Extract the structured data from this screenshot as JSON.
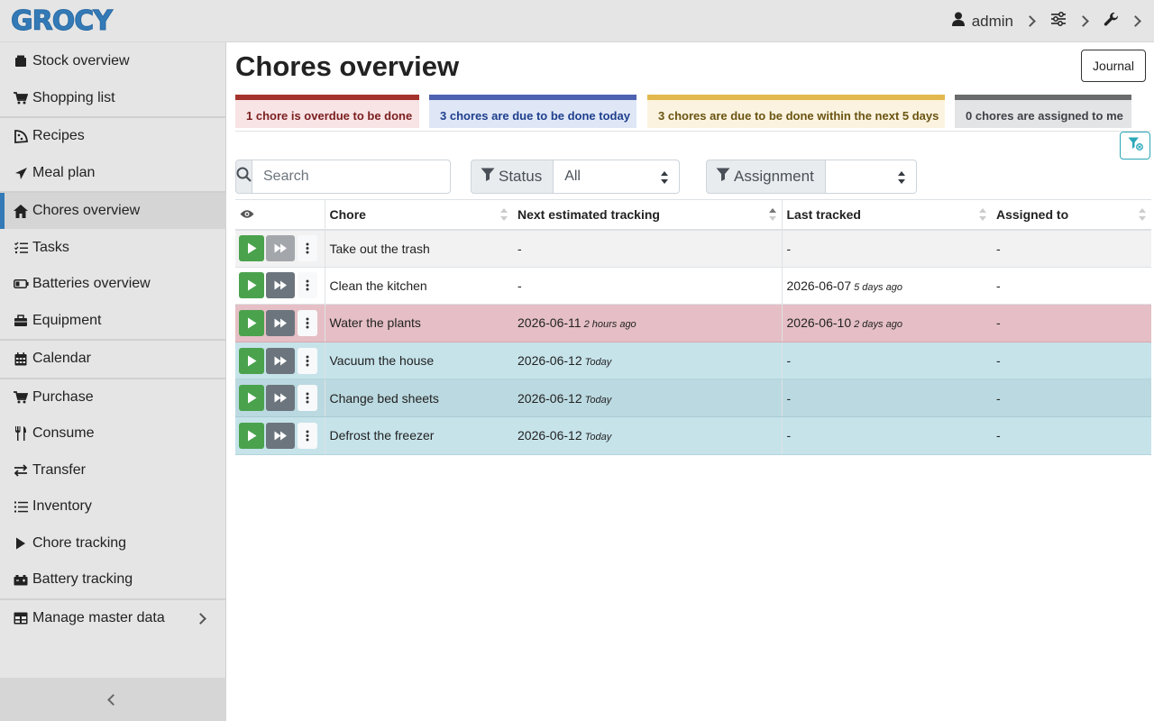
{
  "app": {
    "logo": "GROCY"
  },
  "topbar": {
    "user": "admin"
  },
  "sidebar": {
    "items": [
      {
        "label": "Stock overview"
      },
      {
        "label": "Shopping list"
      },
      {
        "label": "Recipes"
      },
      {
        "label": "Meal plan"
      },
      {
        "label": "Chores overview"
      },
      {
        "label": "Tasks"
      },
      {
        "label": "Batteries overview"
      },
      {
        "label": "Equipment"
      },
      {
        "label": "Calendar"
      },
      {
        "label": "Purchase"
      },
      {
        "label": "Consume"
      },
      {
        "label": "Transfer"
      },
      {
        "label": "Inventory"
      },
      {
        "label": "Chore tracking"
      },
      {
        "label": "Battery tracking"
      },
      {
        "label": "Manage master data"
      }
    ]
  },
  "page": {
    "title": "Chores overview",
    "journal_label": "Journal"
  },
  "status": {
    "overdue": "1 chore is overdue to be done",
    "due_today": "3 chores are due to be done today",
    "due_soon": "3 chores are due to be done within the next 5 days",
    "assigned": "0 chores are assigned to me"
  },
  "filters": {
    "search_placeholder": "Search",
    "status_label": "Status",
    "status_value": "All",
    "assignment_label": "Assignment",
    "assignment_value": ""
  },
  "table": {
    "columns": [
      "Chore",
      "Next estimated tracking",
      "Last tracked",
      "Assigned to"
    ],
    "rows": [
      {
        "chore": "Take out the trash",
        "next": "-",
        "next_rel": "",
        "last": "-",
        "last_rel": "",
        "assigned": "-"
      },
      {
        "chore": "Clean the kitchen",
        "next": "-",
        "next_rel": "",
        "last": "2026-06-07",
        "last_rel": "5 days ago",
        "assigned": "-"
      },
      {
        "chore": "Water the plants",
        "next": "2026-06-11",
        "next_rel": "2 hours ago",
        "last": "2026-06-10",
        "last_rel": "2 days ago",
        "assigned": "-"
      },
      {
        "chore": "Vacuum the house",
        "next": "2026-06-12",
        "next_rel": "Today",
        "last": "-",
        "last_rel": "",
        "assigned": "-"
      },
      {
        "chore": "Change bed sheets",
        "next": "2026-06-12",
        "next_rel": "Today",
        "last": "-",
        "last_rel": "",
        "assigned": "-"
      },
      {
        "chore": "Defrost the freezer",
        "next": "2026-06-12",
        "next_rel": "Today",
        "last": "-",
        "last_rel": "",
        "assigned": "-"
      }
    ]
  },
  "colors": {
    "brand": "#337ab7",
    "track_button": "#4aa24d",
    "overdue_row": "#e5bfc5",
    "today_row": "#c6e3ea"
  }
}
